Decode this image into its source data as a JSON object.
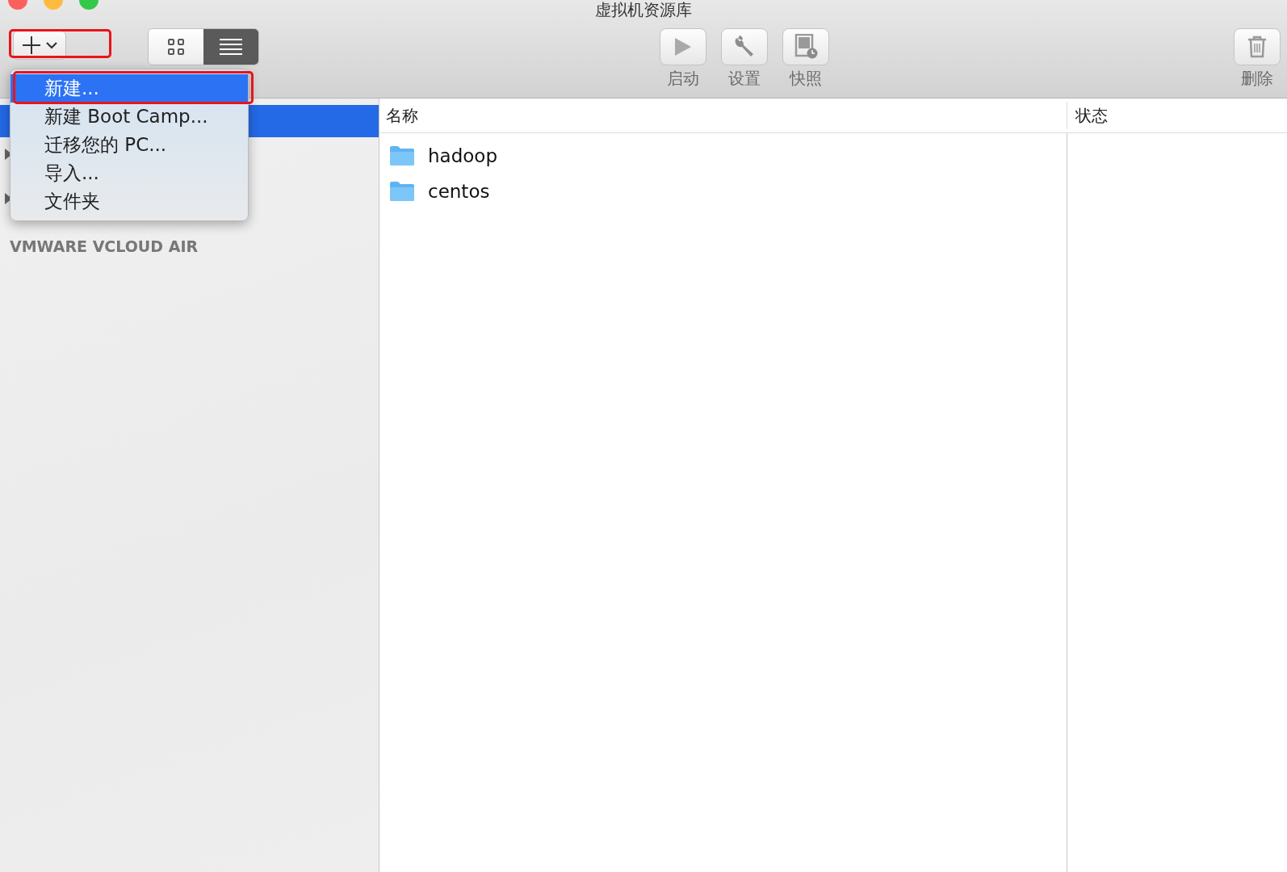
{
  "window": {
    "title": "虚拟机资源库"
  },
  "toolbar": {
    "view_modes": [
      {
        "kind": "grid",
        "selected": false
      },
      {
        "kind": "list",
        "selected": true
      }
    ],
    "actions": [
      {
        "kind": "start",
        "label": "启动"
      },
      {
        "kind": "settings",
        "label": "设置"
      },
      {
        "kind": "snapshot",
        "label": "快照"
      }
    ],
    "delete": {
      "label": "删除"
    }
  },
  "add_menu": {
    "items": [
      {
        "label": "新建...",
        "selected": true
      },
      {
        "label": "新建 Boot Camp...",
        "selected": false
      },
      {
        "label": "迁移您的 PC...",
        "selected": false
      },
      {
        "label": "导入...",
        "selected": false
      },
      {
        "label": "文件夹",
        "selected": false
      }
    ]
  },
  "sidebar": {
    "section": "VMWARE VCLOUD AIR"
  },
  "table": {
    "columns": [
      "名称",
      "状态"
    ],
    "rows": [
      {
        "name": "hadoop"
      },
      {
        "name": "centos"
      }
    ]
  }
}
